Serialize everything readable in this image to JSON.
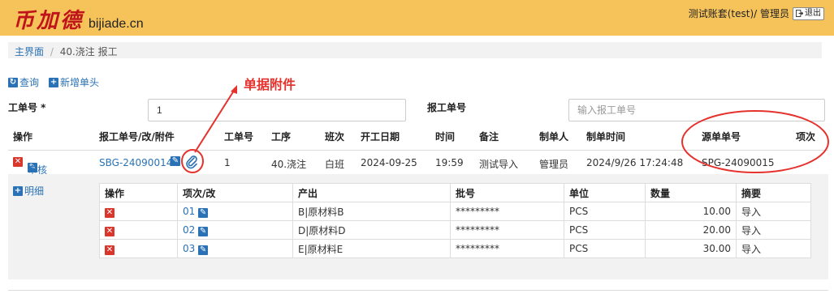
{
  "header": {
    "logo_text": "币加德",
    "logo_domain": "bijiade.cn",
    "user_text": "测试账套(test)/ 管理员",
    "logout_label": "退出"
  },
  "breadcrumb": {
    "home": "主界面",
    "separator": "/",
    "current": "40.浇注 报工"
  },
  "toolbar": {
    "query_label": "查询",
    "new_label": "新增单头"
  },
  "annotation": {
    "label": "单据附件",
    "color": "#e5322d"
  },
  "form": {
    "work_order_label": "工单号 *",
    "work_order_value": "1",
    "report_no_label": "报工单号",
    "report_no_placeholder": "输入报工单号"
  },
  "grid": {
    "headers": {
      "ops": "操作",
      "report_no": "报工单号/改/附件",
      "work_order": "工单号",
      "process": "工序",
      "shift": "班次",
      "start_date": "开工日期",
      "time": "时间",
      "remark": "备注",
      "creator": "制单人",
      "created_time": "制单时间",
      "source_no": "源单单号",
      "item_no": "项次"
    },
    "row": {
      "audit_label": "审核",
      "report_no": "SBG-24090014",
      "work_order": "1",
      "process": "40.浇注",
      "shift": "白班",
      "start_date": "2024-09-25",
      "time": "19:59",
      "remark": "测试导入",
      "creator": "管理员",
      "created_time": "2024/9/26 17:24:48",
      "source_no": "SPG-24090015",
      "item_no": ""
    }
  },
  "detail": {
    "toggle_label": "明细",
    "headers": {
      "ops": "操作",
      "item": "项次/改",
      "output": "产出",
      "batch": "批号",
      "unit": "单位",
      "qty": "数量",
      "summary": "摘要"
    },
    "rows": [
      {
        "item": "01",
        "output": "B|原材料B",
        "batch": "*********",
        "unit": "PCS",
        "qty": "10.00",
        "summary": "导入"
      },
      {
        "item": "02",
        "output": "D|原材料D",
        "batch": "*********",
        "unit": "PCS",
        "qty": "20.00",
        "summary": "导入"
      },
      {
        "item": "03",
        "output": "E|原材料E",
        "batch": "*********",
        "unit": "PCS",
        "qty": "30.00",
        "summary": "导入"
      }
    ]
  },
  "icons": {
    "refresh": "refresh-icon",
    "plus": "plus-icon",
    "delete": "delete-icon",
    "edit": "edit-icon",
    "attachment": "paperclip-icon",
    "logout": "logout-icon"
  },
  "colors": {
    "topbar": "#f6c35a",
    "brand_red": "#c0141b",
    "link_blue": "#2a72b5",
    "delete_red": "#d9362c"
  }
}
